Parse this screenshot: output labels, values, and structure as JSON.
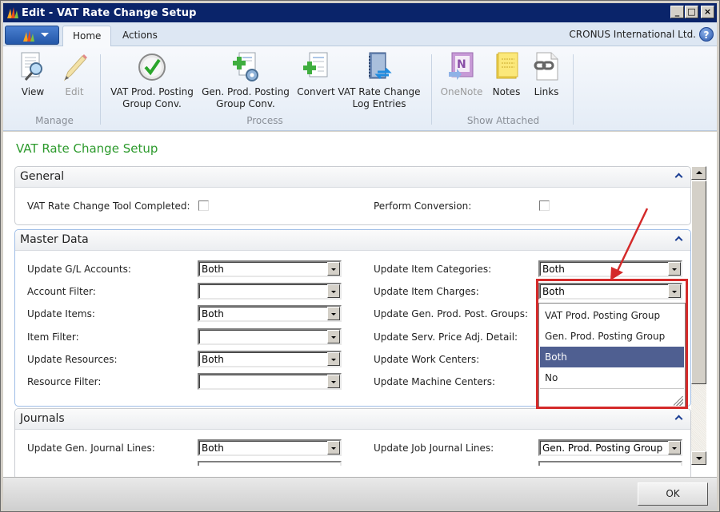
{
  "window": {
    "title": "Edit - VAT Rate Change Setup",
    "controls": {
      "minimize": "_",
      "maximize": "□",
      "close": "×"
    }
  },
  "tabs": [
    {
      "label": "Home",
      "active": true
    },
    {
      "label": "Actions",
      "active": false
    }
  ],
  "company": "CRONUS International Ltd.",
  "help_glyph": "?",
  "ribbon": {
    "groups": [
      {
        "label": "Manage",
        "buttons": [
          {
            "label": "View",
            "icon": "view-document-icon",
            "enabled": true
          },
          {
            "label": "Edit",
            "icon": "pencil-icon",
            "enabled": false
          }
        ]
      },
      {
        "label": "Process",
        "buttons": [
          {
            "label": "VAT Prod. Posting Group Conv.",
            "line1": "VAT Prod. Posting",
            "line2": "Group Conv.",
            "icon": "checkmark-circle-icon",
            "enabled": true
          },
          {
            "label": "Gen. Prod. Posting Group Conv.",
            "line1": "Gen. Prod. Posting",
            "line2": "Group Conv.",
            "icon": "document-add-gear-icon",
            "enabled": true
          },
          {
            "label": "Convert",
            "icon": "document-add-icon",
            "enabled": true
          },
          {
            "label": "VAT Rate Change Log Entries",
            "line1": "VAT Rate Change",
            "line2": "Log Entries",
            "icon": "log-entries-icon",
            "enabled": true
          }
        ]
      },
      {
        "label": "Show Attached",
        "buttons": [
          {
            "label": "OneNote",
            "icon": "onenote-icon",
            "enabled": false
          },
          {
            "label": "Notes",
            "icon": "notes-icon",
            "enabled": true
          },
          {
            "label": "Links",
            "icon": "link-icon",
            "enabled": true
          }
        ]
      }
    ]
  },
  "page_title": "VAT Rate Change Setup",
  "sections": {
    "general": {
      "title": "General",
      "fields": [
        {
          "label": "VAT Rate Change Tool Completed:",
          "type": "checkbox",
          "checked": false
        },
        {
          "label": "Perform Conversion:",
          "type": "checkbox",
          "checked": false
        }
      ]
    },
    "master_data": {
      "title": "Master Data",
      "left": [
        {
          "label": "Update G/L Accounts:",
          "value": "Both"
        },
        {
          "label": "Account Filter:",
          "value": ""
        },
        {
          "label": "Update Items:",
          "value": "Both"
        },
        {
          "label": "Item Filter:",
          "value": ""
        },
        {
          "label": "Update Resources:",
          "value": "Both"
        },
        {
          "label": "Resource Filter:",
          "value": ""
        }
      ],
      "right": [
        {
          "label": "Update Item Categories:",
          "value": "Both"
        },
        {
          "label": "Update Item Charges:",
          "value": "Both"
        },
        {
          "label": "Update Gen. Prod. Post. Groups:",
          "value": ""
        },
        {
          "label": "Update Serv. Price Adj. Detail:",
          "value": ""
        },
        {
          "label": "Update Work Centers:",
          "value": ""
        },
        {
          "label": "Update Machine Centers:",
          "value": ""
        }
      ]
    },
    "journals": {
      "title": "Journals",
      "left": [
        {
          "label": "Update Gen. Journal Lines:",
          "value": "Both"
        }
      ],
      "right": [
        {
          "label": "Update Job Journal Lines:",
          "value": "Gen. Prod. Posting Group"
        }
      ]
    }
  },
  "dropdown": {
    "open_for": "Update Item Charges:",
    "options": [
      "VAT Prod. Posting Group",
      "Gen. Prod. Posting Group",
      "Both",
      "No"
    ],
    "selected": "Both"
  },
  "annotation": {
    "color": "#d42a2a"
  },
  "footer": {
    "ok_label": "OK"
  }
}
